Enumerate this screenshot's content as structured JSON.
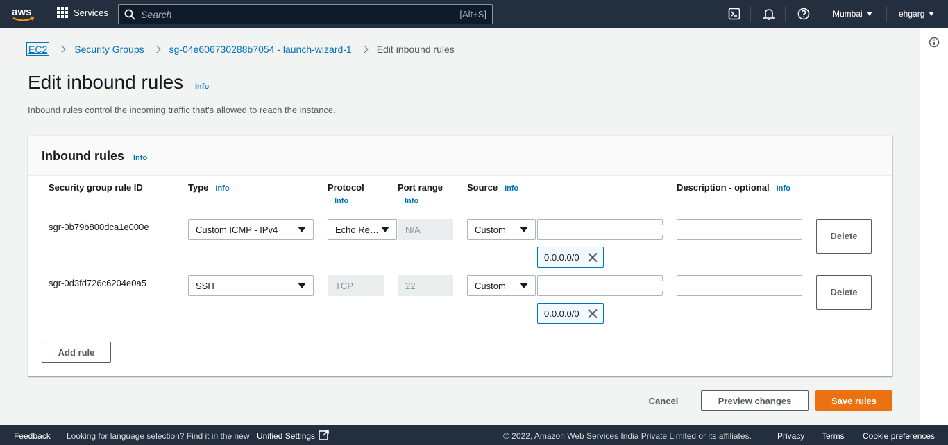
{
  "topnav": {
    "services_label": "Services",
    "search_placeholder": "Search",
    "search_shortcut": "[Alt+S]",
    "region": "Mumbai",
    "user": "ehgarg"
  },
  "breadcrumb": {
    "items": [
      "EC2",
      "Security Groups",
      "sg-04e606730288b7054 - launch-wizard-1"
    ],
    "current": "Edit inbound rules"
  },
  "page": {
    "title": "Edit inbound rules",
    "info": "Info",
    "description": "Inbound rules control the incoming traffic that's allowed to reach the instance."
  },
  "panel": {
    "title": "Inbound rules",
    "info": "Info",
    "columns": {
      "rule_id": "Security group rule ID",
      "type": "Type",
      "protocol": "Protocol",
      "port_range": "Port range",
      "source": "Source",
      "description": "Description - optional",
      "info": "Info"
    },
    "rules": [
      {
        "id": "sgr-0b79b800dca1e000e",
        "type": "Custom ICMP - IPv4",
        "protocol": "Echo Request",
        "port_range": "N/A",
        "source": "Custom",
        "source_search": "",
        "cidr": "0.0.0.0/0",
        "description": "",
        "delete_label": "Delete"
      },
      {
        "id": "sgr-0d3fd726c6204e0a5",
        "type": "SSH",
        "protocol": "TCP",
        "port_range": "22",
        "source": "Custom",
        "source_search": "",
        "cidr": "0.0.0.0/0",
        "description": "",
        "delete_label": "Delete"
      }
    ],
    "add_rule": "Add rule"
  },
  "actions": {
    "cancel": "Cancel",
    "preview": "Preview changes",
    "save": "Save rules"
  },
  "footer": {
    "feedback": "Feedback",
    "language_prompt": "Looking for language selection? Find it in the new",
    "unified_settings": "Unified Settings",
    "copyright": "© 2022, Amazon Web Services India Private Limited or its affiliates.",
    "privacy": "Privacy",
    "terms": "Terms",
    "cookies": "Cookie preferences"
  },
  "colors": {
    "nav_bg": "#232f3e",
    "link": "#0073bb",
    "primary": "#ec7211",
    "page_bg": "#f2f3f3"
  }
}
